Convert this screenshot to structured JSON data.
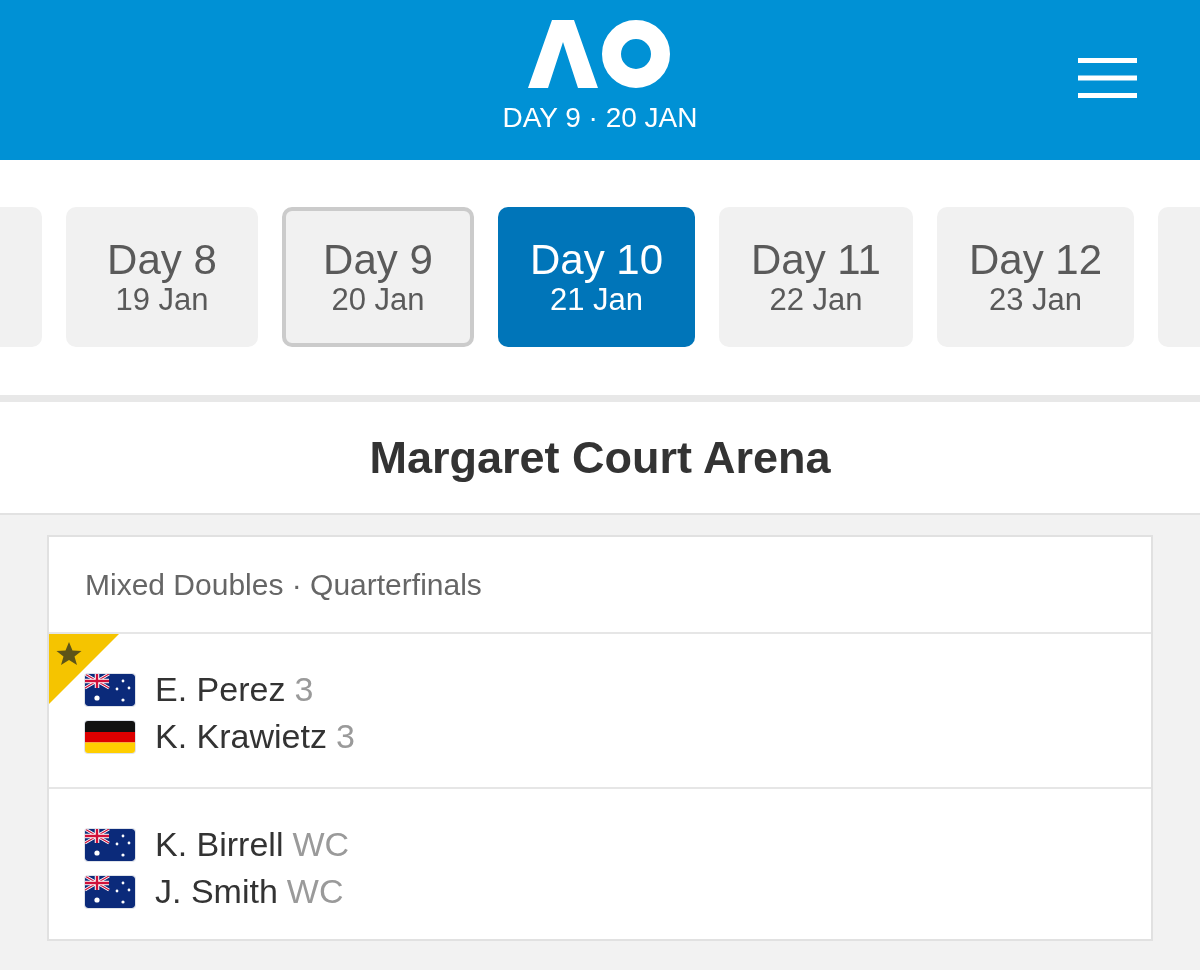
{
  "header": {
    "subtitle": "DAY 9 · 20 JAN"
  },
  "days": [
    {
      "day": "Day 8",
      "date": "19 Jan",
      "selected": false,
      "today": false
    },
    {
      "day": "Day 9",
      "date": "20 Jan",
      "selected": false,
      "today": true
    },
    {
      "day": "Day 10",
      "date": "21 Jan",
      "selected": true,
      "today": false
    },
    {
      "day": "Day 11",
      "date": "22 Jan",
      "selected": false,
      "today": false
    },
    {
      "day": "Day 12",
      "date": "23 Jan",
      "selected": false,
      "today": false
    }
  ],
  "venue": {
    "title": "Margaret Court Arena"
  },
  "match": {
    "event": "Mixed Doubles · Quarterfinals",
    "teams": [
      {
        "winner": true,
        "players": [
          {
            "name": "E. Perez",
            "seed": "3",
            "kind": "australia"
          },
          {
            "name": "K. Krawietz",
            "seed": "3",
            "kind": "germany"
          }
        ]
      },
      {
        "winner": false,
        "players": [
          {
            "name": "K. Birrell",
            "seed": "WC",
            "kind": "australia"
          },
          {
            "name": "J. Smith",
            "seed": "WC",
            "kind": "australia"
          }
        ]
      }
    ]
  }
}
